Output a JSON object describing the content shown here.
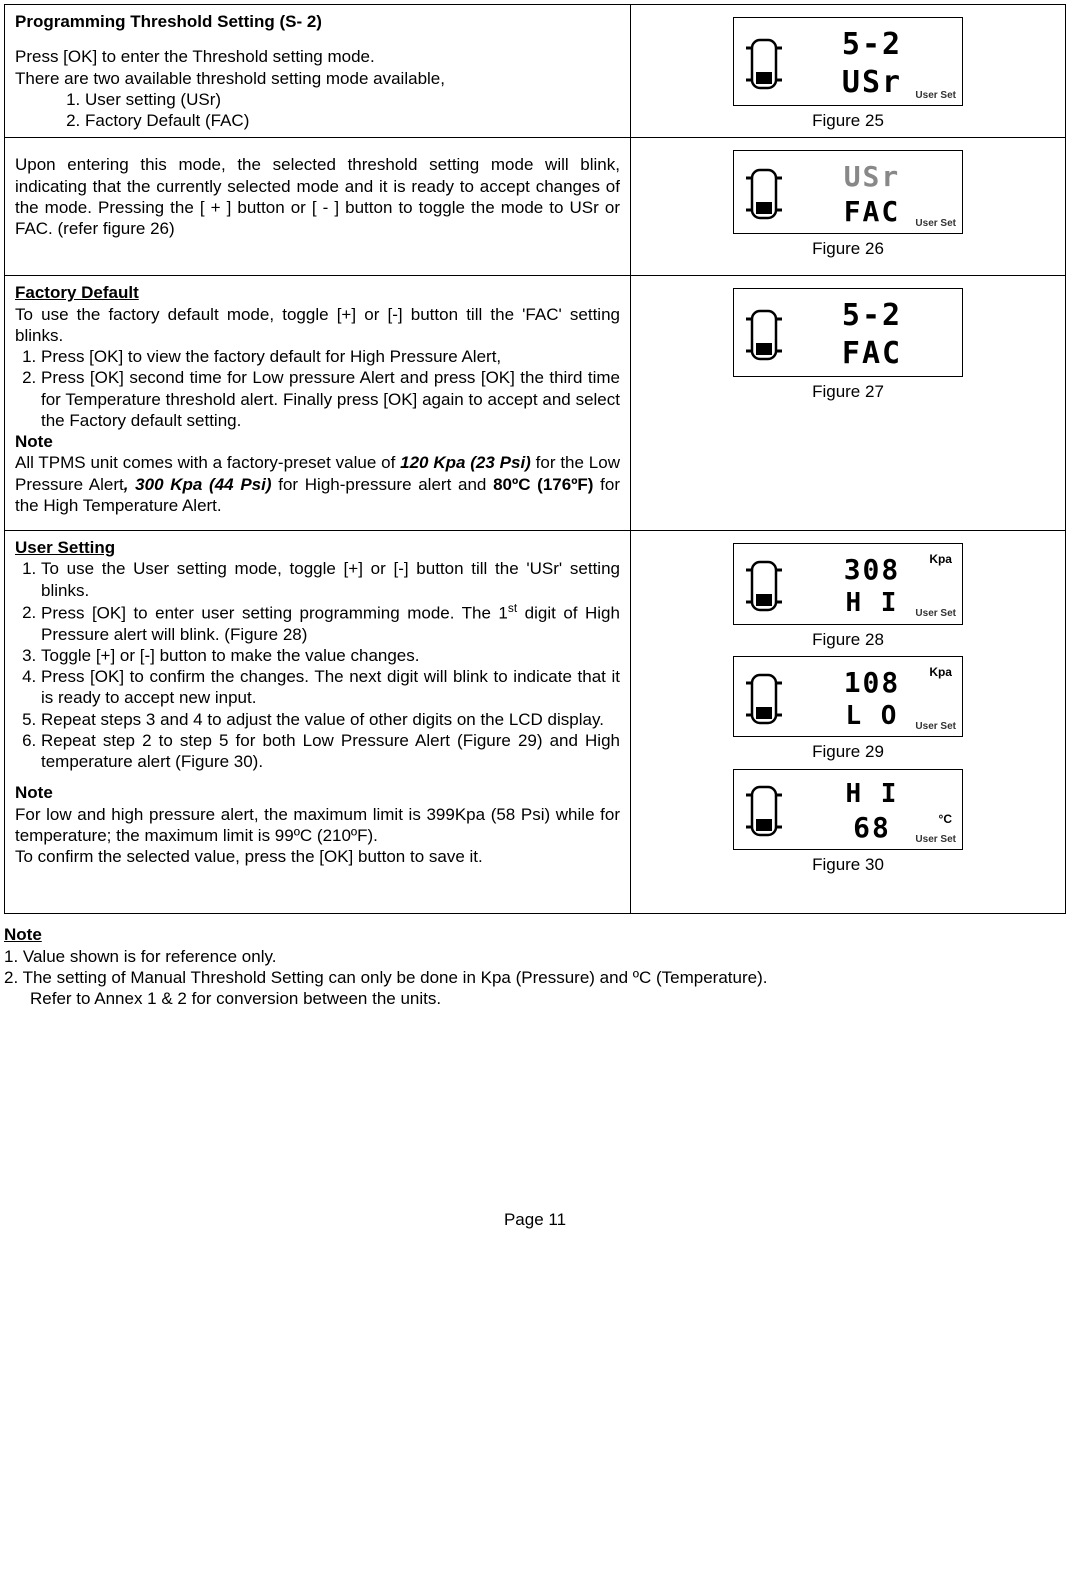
{
  "header": {
    "title": "Programming Threshold Setting (S- 2)",
    "intro1": "Press [OK] to enter the Threshold setting mode.",
    "intro2": "There are two available threshold setting mode available,",
    "opt1": "User setting (USr)",
    "opt2": "Factory Default (FAC)",
    "fig25": "Figure 25"
  },
  "row2": {
    "text": "Upon entering this mode, the selected threshold setting mode will blink, indicating that the currently selected mode and it is ready to accept changes of the mode. Pressing the [ + ] button or [ - ] button to toggle the mode to USr or FAC. (refer figure 26)",
    "fig26": "Figure 26"
  },
  "factory": {
    "heading": "Factory Default",
    "intro": "To use the factory default mode, toggle [+] or [-] button till the 'FAC' setting blinks.",
    "step1": "Press [OK] to view the factory default for High Pressure Alert,",
    "step2": "Press [OK] second time for Low pressure Alert and press [OK] the third time for Temperature threshold alert. Finally press [OK] again to accept and select the Factory default setting.",
    "noteHeading": "Note",
    "note_a": "All TPMS unit comes with a factory-preset value of ",
    "note_b": "120 Kpa (23 Psi)",
    "note_c": " for the Low Pressure Alert",
    "note_d": ", 300 Kpa (44 Psi)",
    "note_e": " for High-pressure alert and ",
    "note_f": "80ºC (176ºF)",
    "note_g": " for the High Temperature Alert.",
    "fig27": "Figure 27"
  },
  "user": {
    "heading": "User Setting",
    "step1": "To use the User setting mode, toggle [+] or [-] button till the 'USr' setting blinks.",
    "step2a": "Press [OK] to enter user setting programming mode. The 1",
    "step2b": " digit of High Pressure alert will blink. (Figure 28)",
    "step3": "Toggle [+] or [-] button to make the value changes.",
    "step4": "Press [OK] to confirm the changes. The next digit will blink to indicate that it is ready to accept new input.",
    "step5": "Repeat steps 3 and 4 to adjust the value of other digits on the LCD display.",
    "step6": "Repeat step 2 to step 5 for both Low Pressure Alert (Figure 29) and High temperature alert (Figure 30).",
    "noteHeading": "Note",
    "noteText1": "For low and high pressure alert, the maximum limit is 399Kpa (58 Psi) while for temperature; the maximum limit is 99ºC (210ºF).",
    "noteText2": "To confirm the selected value, press the [OK] button to save it.",
    "fig28": "Figure 28",
    "fig29": "Figure 29",
    "fig30": "Figure 30"
  },
  "bottomNote": {
    "heading": "Note",
    "l1": "1. Value shown is for reference only.",
    "l2": "2. The setting of Manual Threshold Setting can only be done in Kpa (Pressure) and ºC (Temperature).",
    "l3": "Refer to Annex 1 & 2 for conversion between the units."
  },
  "devices": {
    "fig25": {
      "line1": "5-2",
      "line2": "USr",
      "corner": "User Set"
    },
    "fig26": {
      "line1": "USr",
      "line2": "FAC",
      "corner": "User Set"
    },
    "fig27": {
      "line1": "5-2",
      "line2": "FAC"
    },
    "fig28": {
      "line1": "308",
      "line2": "H I",
      "unit": "Kpa",
      "corner": "User Set"
    },
    "fig29": {
      "line1": "108",
      "line2": "L O",
      "unit": "Kpa",
      "corner": "User Set"
    },
    "fig30": {
      "line1": "H I",
      "line2": "68",
      "unit": "°C",
      "corner": "User Set"
    }
  },
  "footer": {
    "page": "Page 11"
  }
}
